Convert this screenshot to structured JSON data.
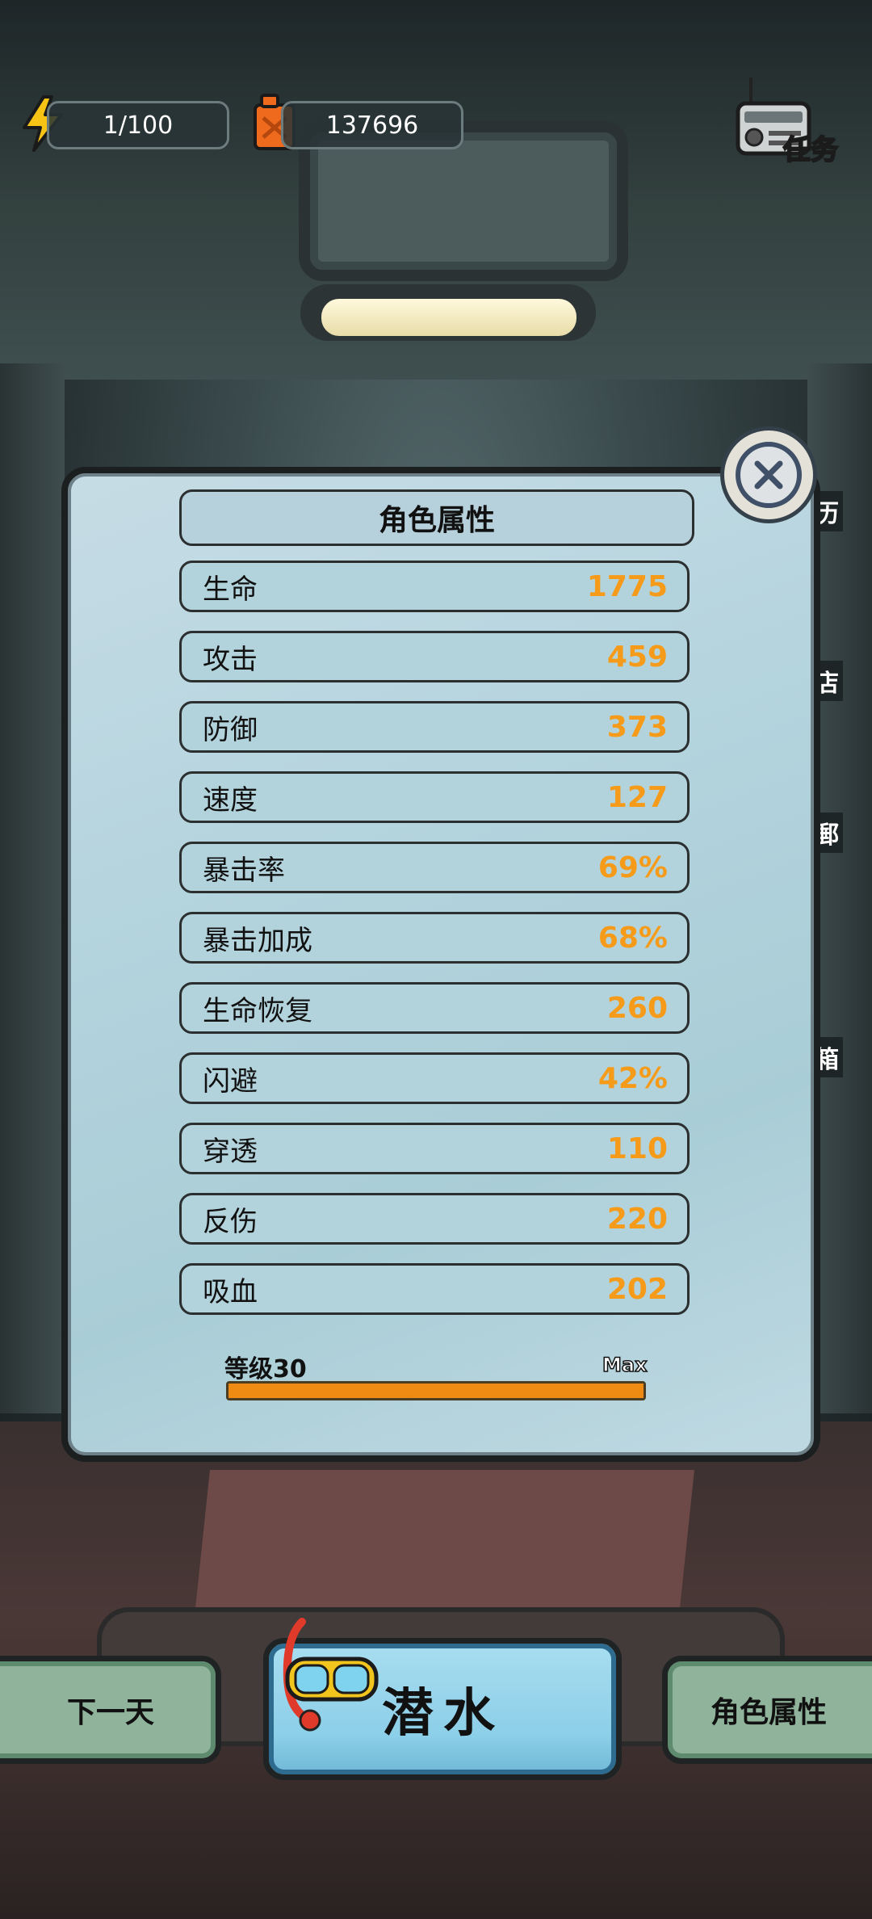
{
  "hud": {
    "energy": "1/100",
    "fuel": "137696",
    "task_label": "任务"
  },
  "side_tags": [
    "历",
    "店",
    "郵",
    "箱"
  ],
  "modal": {
    "title": "角色属性",
    "stats": [
      {
        "label": "生命",
        "value": "1775"
      },
      {
        "label": "攻击",
        "value": "459"
      },
      {
        "label": "防御",
        "value": "373"
      },
      {
        "label": "速度",
        "value": "127"
      },
      {
        "label": "暴击率",
        "value": "69%"
      },
      {
        "label": "暴击加成",
        "value": "68%"
      },
      {
        "label": "生命恢复",
        "value": "260"
      },
      {
        "label": "闪避",
        "value": "42%"
      },
      {
        "label": "穿透",
        "value": "110"
      },
      {
        "label": "反伤",
        "value": "220"
      },
      {
        "label": "吸血",
        "value": "202"
      }
    ],
    "level_label": "等级30",
    "level_max": "Max",
    "level_progress": 1.0
  },
  "bottom": {
    "next_day": "下一天",
    "dive": "潜水",
    "attributes": "角色属性"
  },
  "colors": {
    "value_orange": "#f59b19",
    "panel_blue": "#b3d3dc",
    "button_green": "#8fb39b",
    "dive_blue": "#8ccfe8"
  }
}
